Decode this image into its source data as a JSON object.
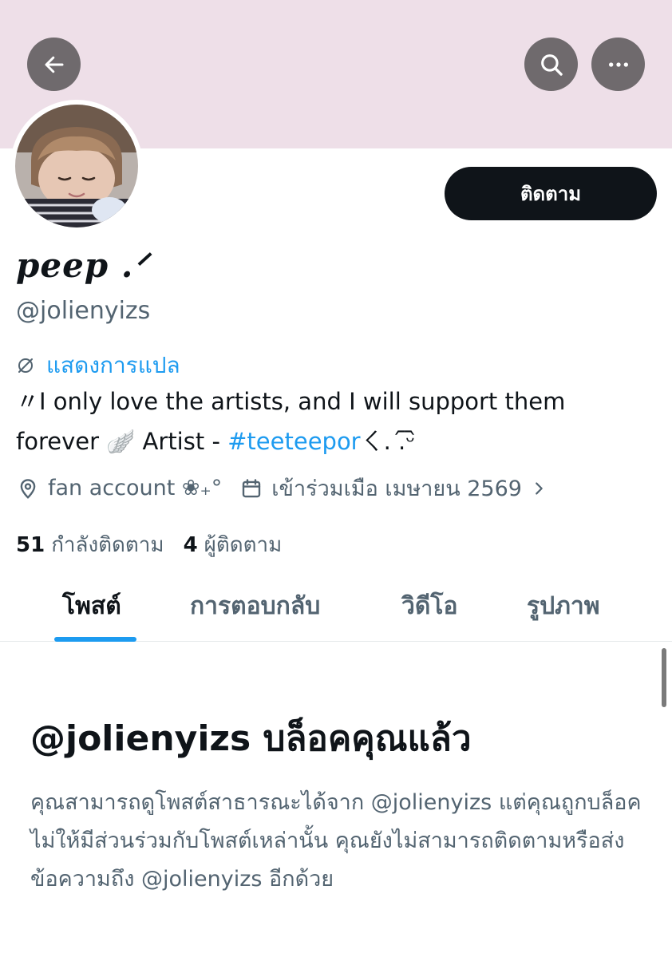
{
  "colors": {
    "banner": "#eedfe8",
    "accent": "#1d9bf0",
    "primary_text": "#0f1419",
    "secondary_text": "#536471",
    "follow_button_bg": "#0f1419"
  },
  "header": {
    "back_icon": "arrow-left-icon",
    "search_icon": "search-icon",
    "more_icon": "more-horizontal-icon"
  },
  "profile": {
    "follow_label": "ติดตาม",
    "display_name": "peep .ᐟ",
    "handle": "@jolienyizs",
    "translate_label": "แสดงการแปล",
    "bio_prefix": "〃I only love the artists, and I will support them forever 🪽 Artist - ",
    "bio_hashtag": "#teeteepor",
    "bio_suffix": "ㄑ. .᷇ᵕ᷆",
    "location": "fan account ❀₊°",
    "joined": "เข้าร่วมเมือ เมษายน 2569",
    "following_count": "51",
    "following_label": "กำลังติดตาม",
    "followers_count": "4",
    "followers_label": "ผู้ติดตาม"
  },
  "tabs": [
    {
      "label": "โพสต์",
      "active": true
    },
    {
      "label": "การตอบกลับ",
      "active": false
    },
    {
      "label": "วิดีโอ",
      "active": false
    },
    {
      "label": "รูปภาพ",
      "active": false
    }
  ],
  "blocked": {
    "title": "@jolienyizs บล็อคคุณแล้ว",
    "body": "คุณสามารถดูโพสต์สาธารณะได้จาก @jolienyizs แต่คุณถูกบล็อคไม่ให้มีส่วนร่วมกับโพสต์เหล่านั้น คุณยังไม่สามารถติดตามหรือส่งข้อความถึง @jolienyizs อีกด้วย"
  }
}
